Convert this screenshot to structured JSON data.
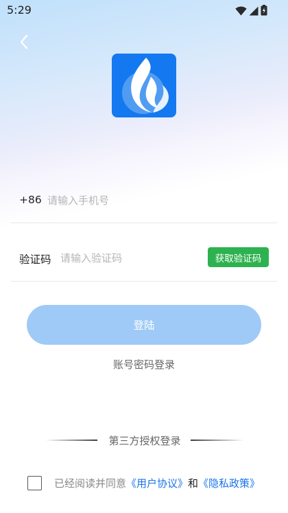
{
  "status_bar": {
    "time": "5:29",
    "icons": [
      "wifi-icon",
      "signal-icon",
      "battery-icon"
    ]
  },
  "header": {
    "back_icon": "chevron-left-icon",
    "logo_icon": "flame-logo-icon"
  },
  "phone": {
    "prefix": "+86",
    "value": "",
    "placeholder": "请输入手机号"
  },
  "code": {
    "label": "验证码",
    "value": "",
    "placeholder": "请输入验证码",
    "button": "获取验证码"
  },
  "login": {
    "button": "登陆",
    "password_login": "账号密码登录"
  },
  "third_party": {
    "label": "第三方授权登录"
  },
  "agreement": {
    "prefix": "已经阅读并同意",
    "user_agreement": "《用户协议》",
    "and": "和",
    "privacy_policy": "《隐私政策》",
    "checked": false
  },
  "colors": {
    "brand": "#1479f0",
    "green": "#2eb24f",
    "login_button": "#9fcaf8",
    "link": "#1a73e8"
  }
}
